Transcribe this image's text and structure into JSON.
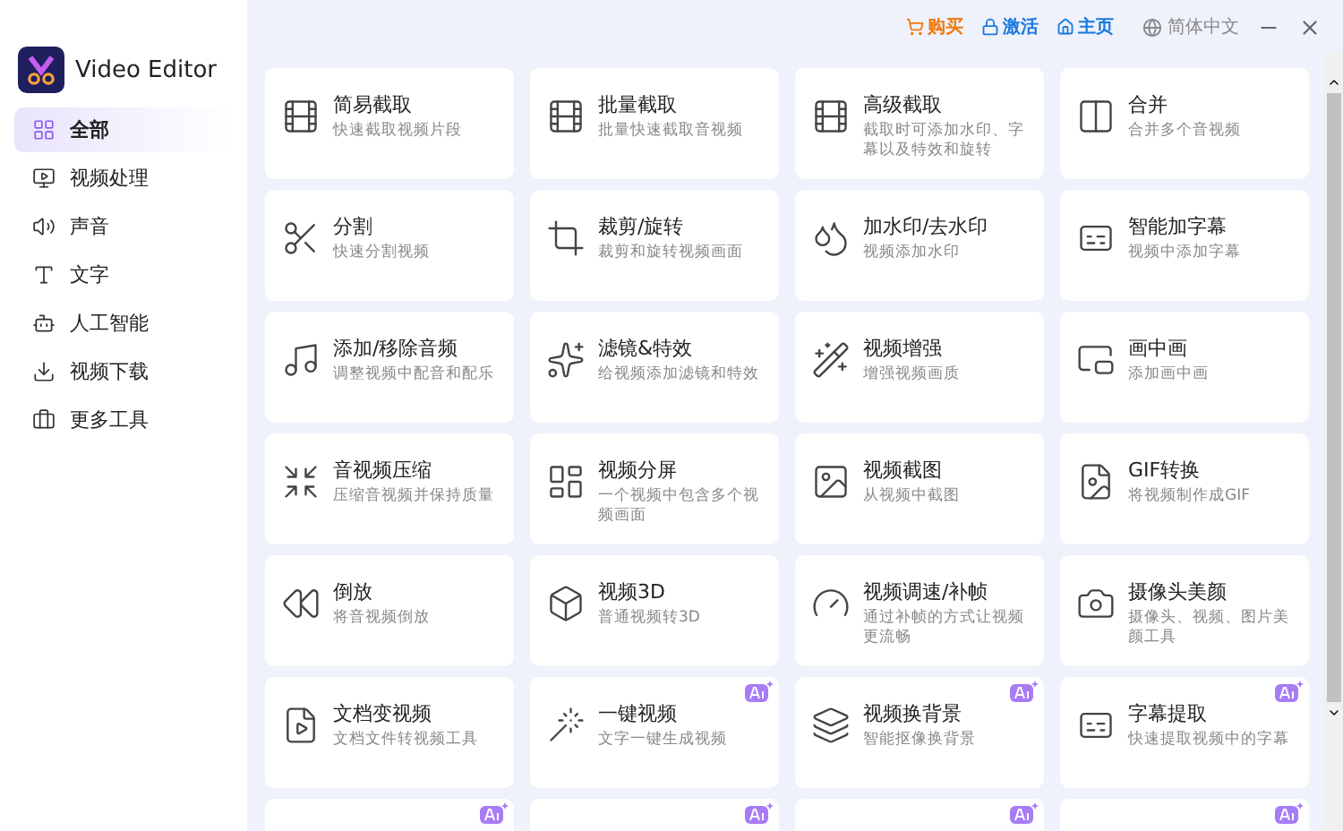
{
  "app": {
    "title": "Video Editor"
  },
  "top_bar": {
    "links": [
      {
        "label": "购买",
        "kind": "buy"
      },
      {
        "label": "激活",
        "kind": "activate"
      },
      {
        "label": "主页",
        "kind": "home"
      }
    ],
    "language": "简体中文"
  },
  "sidebar": {
    "items": [
      {
        "label": "全部",
        "selected": true
      },
      {
        "label": "视频处理",
        "selected": false
      },
      {
        "label": "声音",
        "selected": false
      },
      {
        "label": "文字",
        "selected": false
      },
      {
        "label": "人工智能",
        "selected": false
      },
      {
        "label": "视频下载",
        "selected": false
      },
      {
        "label": "更多工具",
        "selected": false
      }
    ]
  },
  "tools": [
    {
      "title": "简易截取",
      "description": "快速截取视频片段",
      "ai": false
    },
    {
      "title": "批量截取",
      "description": "批量快速截取音视频",
      "ai": false
    },
    {
      "title": "高级截取",
      "description": "截取时可添加水印、字幕以及特效和旋转",
      "ai": false
    },
    {
      "title": "合并",
      "description": "合并多个音视频",
      "ai": false
    },
    {
      "title": "分割",
      "description": "快速分割视频",
      "ai": false
    },
    {
      "title": "裁剪/旋转",
      "description": "裁剪和旋转视频画面",
      "ai": false
    },
    {
      "title": "加水印/去水印",
      "description": "视频添加水印",
      "ai": false
    },
    {
      "title": "智能加字幕",
      "description": "视频中添加字幕",
      "ai": false
    },
    {
      "title": "添加/移除音频",
      "description": "调整视频中配音和配乐",
      "ai": false
    },
    {
      "title": "滤镜&特效",
      "description": "给视频添加滤镜和特效",
      "ai": false
    },
    {
      "title": "视频增强",
      "description": "增强视频画质",
      "ai": false
    },
    {
      "title": "画中画",
      "description": "添加画中画",
      "ai": false
    },
    {
      "title": "音视频压缩",
      "description": "压缩音视频并保持质量",
      "ai": false
    },
    {
      "title": "视频分屏",
      "description": "一个视频中包含多个视频画面",
      "ai": false
    },
    {
      "title": "视频截图",
      "description": "从视频中截图",
      "ai": false
    },
    {
      "title": "GIF转换",
      "description": "将视频制作成GIF",
      "ai": false
    },
    {
      "title": "倒放",
      "description": "将音视频倒放",
      "ai": false
    },
    {
      "title": "视频3D",
      "description": "普通视频转3D",
      "ai": false
    },
    {
      "title": "视频调速/补帧",
      "description": "通过补帧的方式让视频更流畅",
      "ai": false
    },
    {
      "title": "摄像头美颜",
      "description": "摄像头、视频、图片美颜工具",
      "ai": false
    },
    {
      "title": "文档变视频",
      "description": "文档文件转视频工具",
      "ai": false
    },
    {
      "title": "一键视频",
      "description": "文字一键生成视频",
      "ai": true
    },
    {
      "title": "视频换背景",
      "description": "智能抠像换背景",
      "ai": true
    },
    {
      "title": "字幕提取",
      "description": "快速提取视频中的字幕",
      "ai": true
    }
  ],
  "partial_tools": [
    {
      "ai": true
    },
    {
      "ai": true
    },
    {
      "ai": true
    },
    {
      "ai": true
    }
  ]
}
